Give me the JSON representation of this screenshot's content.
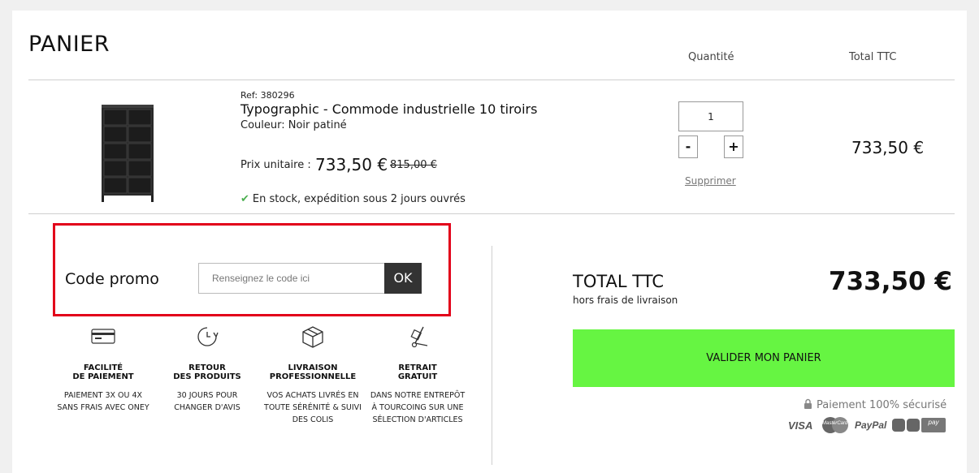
{
  "header": {
    "title": "PANIER",
    "col_quantity": "Quantité",
    "col_total": "Total TTC"
  },
  "product": {
    "ref": "Ref: 380296",
    "name": "Typographic - Commode industrielle 10 tiroirs",
    "color": "Couleur: Noir patiné",
    "unit_label": "Prix unitaire :",
    "unit_price": "733,50 €",
    "old_price": "815,00 €",
    "stock": "En stock, expédition sous 2 jours ouvrés",
    "quantity": "1",
    "minus": "-",
    "plus": "+",
    "remove": "Supprimer",
    "line_total": "733,50 €"
  },
  "promo": {
    "label": "Code promo",
    "placeholder": "Renseignez le code ici",
    "ok": "OK"
  },
  "features": [
    {
      "icon": "credit-card-icon",
      "title": "FACILITÉ\nDE PAIEMENT",
      "desc": "PAIEMENT 3X OU 4X\nSANS FRAIS AVEC ONEY"
    },
    {
      "icon": "return-clock-icon",
      "title": "RETOUR\nDES PRODUITS",
      "desc": "30 JOURS POUR\nCHANGER D'AVIS"
    },
    {
      "icon": "package-box-icon",
      "title": "LIVRAISON\nPROFESSIONNELLE",
      "desc": "VOS ACHATS LIVRÉS EN\nTOUTE SÉRÉNITÉ & SUIVI\nDES COLIS"
    },
    {
      "icon": "hand-truck-icon",
      "title": "RETRAIT\nGRATUIT",
      "desc": "DANS NOTRE ENTREPÔT\nÀ TOURCOING SUR UNE\nSÉLECTION D'ARTICLES"
    }
  ],
  "summary": {
    "total_label": "TOTAL TTC",
    "total_sub": "hors frais de livraison",
    "total_amount": "733,50 €",
    "validate": "VALIDER MON PANIER",
    "secure": "Paiement 100% sécurisé",
    "payment_logos": [
      "VISA",
      "MasterCard",
      "PayPal",
      "",
      "pay"
    ]
  },
  "colors": {
    "accent_green": "#66f542",
    "promo_highlight": "#e2001a",
    "stock_check": "#4caf50"
  }
}
